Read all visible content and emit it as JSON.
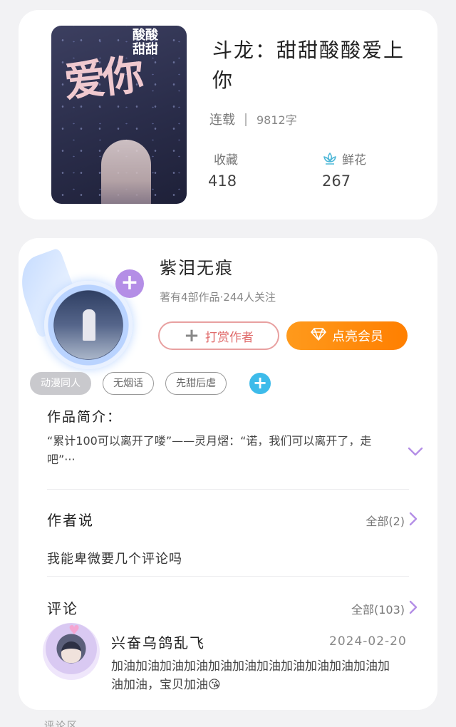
{
  "book": {
    "title": "斗龙：甜甜酸酸爱上你",
    "status": "连载",
    "word_count": "9812字",
    "favorites_label": "收藏",
    "favorites_value": "418",
    "flowers_label": "鲜花",
    "flowers_value": "267",
    "cover": {
      "big_text": "爱你",
      "small_text": "酸酸\n甜甜"
    }
  },
  "author": {
    "name": "紫泪无痕",
    "subtitle": "著有4部作品·244人关注",
    "tip_label": "打赏作者",
    "vip_label": "点亮会员"
  },
  "tags": [
    "动漫同人",
    "无烟话",
    "先甜后虐"
  ],
  "intro": {
    "heading": "作品简介：",
    "text": "“累计100可以离开了喽”——灵月熠：“诺，我们可以离开了，走吧”···"
  },
  "author_says": {
    "heading": "作者说",
    "more": "全部(2)",
    "text": "我能卑微要几个评论吗"
  },
  "comments": {
    "heading": "评论",
    "more": "全部(103)",
    "items": [
      {
        "user": "兴奋乌鸽乱飞",
        "date": "2024-02-20",
        "text": "加油加油加油加油加油加油加油加油加油加油加油加油加油，宝贝加油😘"
      }
    ]
  },
  "colors": {
    "accent_orange": "#ff8a0e",
    "accent_purple": "#b48ee6",
    "accent_blue": "#3dbbea",
    "tip_border": "#e8a0a0"
  },
  "next_section_peek": "评论区"
}
